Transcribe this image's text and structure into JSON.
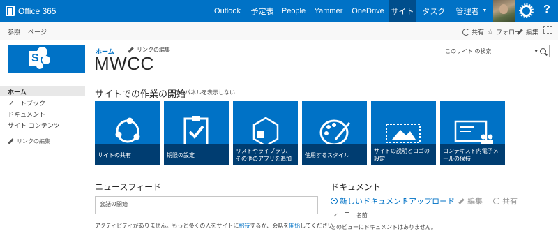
{
  "suite_bar": {
    "brand": "Office 365",
    "nav": [
      "Outlook",
      "予定表",
      "People",
      "Yammer",
      "OneDrive",
      "サイト",
      "タスク",
      "管理者"
    ],
    "active_nav": "サイト",
    "accent_color": "#0072c6"
  },
  "ribbon": {
    "tabs": [
      "参照",
      "ページ"
    ],
    "actions": {
      "share": "共有",
      "follow": "フォロー",
      "edit": "編集"
    }
  },
  "site": {
    "breadcrumb": "ホーム",
    "edit_links": "リンクの編集",
    "title": "MWCC",
    "search_placeholder": "このサイト の検索"
  },
  "left_nav": {
    "items": [
      "ホーム",
      "ノートブック",
      "ドキュメント",
      "サイト コンテンツ"
    ],
    "selected": "ホーム",
    "edit_links": "リンクの編集"
  },
  "getting_started": {
    "title": "サイトでの作業の開始",
    "hide_link": "このパネルを表示しない",
    "tiles": [
      {
        "label": "サイトの共有",
        "icon": "share-icon"
      },
      {
        "label": "期限の設定",
        "icon": "clipboard-check-icon"
      },
      {
        "label": "リストやライブラリ、その他のアプリを追加",
        "icon": "hexagon-app-icon"
      },
      {
        "label": "使用するスタイル",
        "icon": "palette-icon"
      },
      {
        "label": "サイトの説明とロゴの設定",
        "icon": "picture-icon"
      },
      {
        "label": "コンテキスト内電子メールの保持",
        "icon": "contact-card-icon"
      }
    ]
  },
  "newsfeed": {
    "title": "ニュースフィード",
    "input_placeholder": "会話の開始",
    "empty_pre": "アクティビティがありません。もっと多くの人をサイトに",
    "empty_link1": "招待",
    "empty_mid": "するか、会話を",
    "empty_link2": "開始",
    "empty_post": "してください。"
  },
  "documents": {
    "title": "ドキュメント",
    "new_doc": "新しいドキュメント",
    "upload": "アップロード",
    "edit": "編集",
    "share": "共有",
    "col_name": "名前",
    "empty": "このビューにドキュメントはありません。"
  }
}
